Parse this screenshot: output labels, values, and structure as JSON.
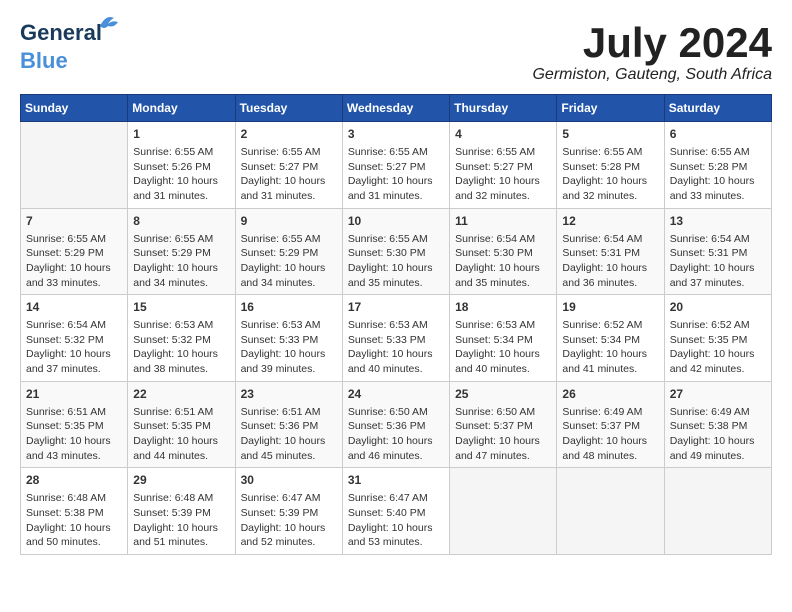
{
  "logo": {
    "line1": "General",
    "line2": "Blue"
  },
  "title": "July 2024",
  "location": "Germiston, Gauteng, South Africa",
  "days_of_week": [
    "Sunday",
    "Monday",
    "Tuesday",
    "Wednesday",
    "Thursday",
    "Friday",
    "Saturday"
  ],
  "weeks": [
    [
      {
        "day": "",
        "content": ""
      },
      {
        "day": "1",
        "content": "Sunrise: 6:55 AM\nSunset: 5:26 PM\nDaylight: 10 hours and 31 minutes."
      },
      {
        "day": "2",
        "content": "Sunrise: 6:55 AM\nSunset: 5:27 PM\nDaylight: 10 hours and 31 minutes."
      },
      {
        "day": "3",
        "content": "Sunrise: 6:55 AM\nSunset: 5:27 PM\nDaylight: 10 hours and 31 minutes."
      },
      {
        "day": "4",
        "content": "Sunrise: 6:55 AM\nSunset: 5:27 PM\nDaylight: 10 hours and 32 minutes."
      },
      {
        "day": "5",
        "content": "Sunrise: 6:55 AM\nSunset: 5:28 PM\nDaylight: 10 hours and 32 minutes."
      },
      {
        "day": "6",
        "content": "Sunrise: 6:55 AM\nSunset: 5:28 PM\nDaylight: 10 hours and 33 minutes."
      }
    ],
    [
      {
        "day": "7",
        "content": "Sunrise: 6:55 AM\nSunset: 5:29 PM\nDaylight: 10 hours and 33 minutes."
      },
      {
        "day": "8",
        "content": "Sunrise: 6:55 AM\nSunset: 5:29 PM\nDaylight: 10 hours and 34 minutes."
      },
      {
        "day": "9",
        "content": "Sunrise: 6:55 AM\nSunset: 5:29 PM\nDaylight: 10 hours and 34 minutes."
      },
      {
        "day": "10",
        "content": "Sunrise: 6:55 AM\nSunset: 5:30 PM\nDaylight: 10 hours and 35 minutes."
      },
      {
        "day": "11",
        "content": "Sunrise: 6:54 AM\nSunset: 5:30 PM\nDaylight: 10 hours and 35 minutes."
      },
      {
        "day": "12",
        "content": "Sunrise: 6:54 AM\nSunset: 5:31 PM\nDaylight: 10 hours and 36 minutes."
      },
      {
        "day": "13",
        "content": "Sunrise: 6:54 AM\nSunset: 5:31 PM\nDaylight: 10 hours and 37 minutes."
      }
    ],
    [
      {
        "day": "14",
        "content": "Sunrise: 6:54 AM\nSunset: 5:32 PM\nDaylight: 10 hours and 37 minutes."
      },
      {
        "day": "15",
        "content": "Sunrise: 6:53 AM\nSunset: 5:32 PM\nDaylight: 10 hours and 38 minutes."
      },
      {
        "day": "16",
        "content": "Sunrise: 6:53 AM\nSunset: 5:33 PM\nDaylight: 10 hours and 39 minutes."
      },
      {
        "day": "17",
        "content": "Sunrise: 6:53 AM\nSunset: 5:33 PM\nDaylight: 10 hours and 40 minutes."
      },
      {
        "day": "18",
        "content": "Sunrise: 6:53 AM\nSunset: 5:34 PM\nDaylight: 10 hours and 40 minutes."
      },
      {
        "day": "19",
        "content": "Sunrise: 6:52 AM\nSunset: 5:34 PM\nDaylight: 10 hours and 41 minutes."
      },
      {
        "day": "20",
        "content": "Sunrise: 6:52 AM\nSunset: 5:35 PM\nDaylight: 10 hours and 42 minutes."
      }
    ],
    [
      {
        "day": "21",
        "content": "Sunrise: 6:51 AM\nSunset: 5:35 PM\nDaylight: 10 hours and 43 minutes."
      },
      {
        "day": "22",
        "content": "Sunrise: 6:51 AM\nSunset: 5:35 PM\nDaylight: 10 hours and 44 minutes."
      },
      {
        "day": "23",
        "content": "Sunrise: 6:51 AM\nSunset: 5:36 PM\nDaylight: 10 hours and 45 minutes."
      },
      {
        "day": "24",
        "content": "Sunrise: 6:50 AM\nSunset: 5:36 PM\nDaylight: 10 hours and 46 minutes."
      },
      {
        "day": "25",
        "content": "Sunrise: 6:50 AM\nSunset: 5:37 PM\nDaylight: 10 hours and 47 minutes."
      },
      {
        "day": "26",
        "content": "Sunrise: 6:49 AM\nSunset: 5:37 PM\nDaylight: 10 hours and 48 minutes."
      },
      {
        "day": "27",
        "content": "Sunrise: 6:49 AM\nSunset: 5:38 PM\nDaylight: 10 hours and 49 minutes."
      }
    ],
    [
      {
        "day": "28",
        "content": "Sunrise: 6:48 AM\nSunset: 5:38 PM\nDaylight: 10 hours and 50 minutes."
      },
      {
        "day": "29",
        "content": "Sunrise: 6:48 AM\nSunset: 5:39 PM\nDaylight: 10 hours and 51 minutes."
      },
      {
        "day": "30",
        "content": "Sunrise: 6:47 AM\nSunset: 5:39 PM\nDaylight: 10 hours and 52 minutes."
      },
      {
        "day": "31",
        "content": "Sunrise: 6:47 AM\nSunset: 5:40 PM\nDaylight: 10 hours and 53 minutes."
      },
      {
        "day": "",
        "content": ""
      },
      {
        "day": "",
        "content": ""
      },
      {
        "day": "",
        "content": ""
      }
    ]
  ]
}
